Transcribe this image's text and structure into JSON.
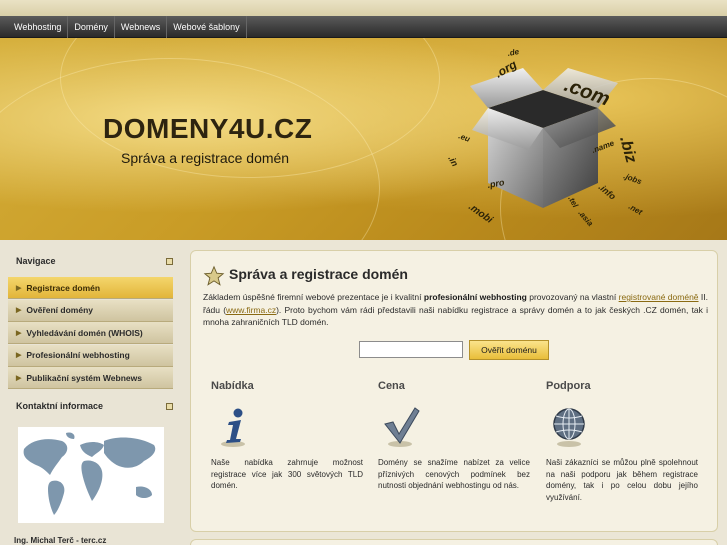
{
  "topnav": {
    "items": [
      "Webhosting",
      "Domény",
      "Webnews",
      "Webové šablony"
    ]
  },
  "header": {
    "title": "DOMENY4U.CZ",
    "subtitle": "Správa a registrace domén",
    "box_words": [
      ".com",
      ".biz",
      ".org",
      ".pro",
      ".mobi",
      ".info",
      ".tel",
      ".jobs",
      ".in",
      ".name",
      ".asia",
      ".eu",
      ".net",
      ".de"
    ]
  },
  "sidebar": {
    "nav_heading": "Navigace",
    "menu": [
      {
        "label": "Registrace domén",
        "active": true
      },
      {
        "label": "Ověření domény",
        "active": false
      },
      {
        "label": "Vyhledávání domén (WHOIS)",
        "active": false
      },
      {
        "label": "Profesionální webhosting",
        "active": false
      },
      {
        "label": "Publikační systém Webnews",
        "active": false
      }
    ],
    "contact_heading": "Kontaktní informace",
    "contact_name": "Ing. Michal Terč - terc.cz"
  },
  "main": {
    "title": "Správa a registrace domén",
    "intro": {
      "p1": "Základem úspěšné firemní webové prezentace je i kvalitní ",
      "bold": "profesionální webhosting",
      "p2": " provozovaný na vlastní ",
      "link1": "registrované doméně",
      "p3": " II. řádu (",
      "link2": "www.firma.cz",
      "p4": "). Proto bychom vám rádi představili naši nabídku registrace a správy domén a to jak českých .CZ domén, tak i mnoha zahraničních TLD domén."
    },
    "domain_input": {
      "value": "",
      "placeholder": ""
    },
    "check_button": "Ověřit doménu",
    "columns": [
      {
        "title": "Nabídka",
        "icon": "info-icon",
        "text": "Naše nabídka zahrnuje možnost registrace více jak 300 světových TLD domén."
      },
      {
        "title": "Cena",
        "icon": "checkmark-icon",
        "text": "Domény se snažíme nabízet za velice příznivých cenových podmínek bez nutnosti objednání webhostingu od nás."
      },
      {
        "title": "Podpora",
        "icon": "globe-icon",
        "text": "Naši zákazníci se můžou plně spolehnout na naši podporu jak během registrace domény, tak i po celou dobu jejího využívání."
      }
    ]
  },
  "colors": {
    "accent": "#e9be3a",
    "nav_bg": "#3a3a3a",
    "gold": "#c99c26"
  }
}
